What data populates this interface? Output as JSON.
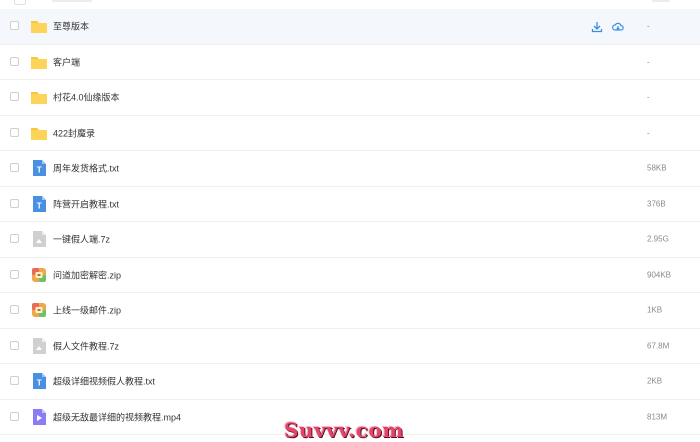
{
  "files": [
    {
      "name": "至尊版本",
      "size": "-",
      "type": "folder",
      "hover": true
    },
    {
      "name": "客户端",
      "size": "-",
      "type": "folder"
    },
    {
      "name": "村花4.0仙缘版本",
      "size": "-",
      "type": "folder"
    },
    {
      "name": "422封魔录",
      "size": "-",
      "type": "folder"
    },
    {
      "name": "周年发货格式.txt",
      "size": "58KB",
      "type": "txt"
    },
    {
      "name": "阵营开启教程.txt",
      "size": "376B",
      "type": "txt"
    },
    {
      "name": "一键假人端.7z",
      "size": "2.95G",
      "type": "archive"
    },
    {
      "name": "问道加密解密.zip",
      "size": "904KB",
      "type": "zip"
    },
    {
      "name": "上线一级邮件.zip",
      "size": "1KB",
      "type": "zip"
    },
    {
      "name": "假人文件教程.7z",
      "size": "67.8M",
      "type": "archive"
    },
    {
      "name": "超级详细视频假人教程.txt",
      "size": "2KB",
      "type": "txt"
    },
    {
      "name": "超级无敌最详细的视频教程.mp4",
      "size": "813M",
      "type": "video"
    }
  ],
  "row_actions": [
    "download-icon",
    "cloud-download-icon"
  ],
  "colors": {
    "folder": "#f9c53a",
    "txt": "#4a90e2",
    "archive": "#d0d0d0",
    "zip": "#f0a64a",
    "video": "#8b7cf6",
    "action": "#3a8ee6"
  },
  "watermark": "Suvvv.com"
}
